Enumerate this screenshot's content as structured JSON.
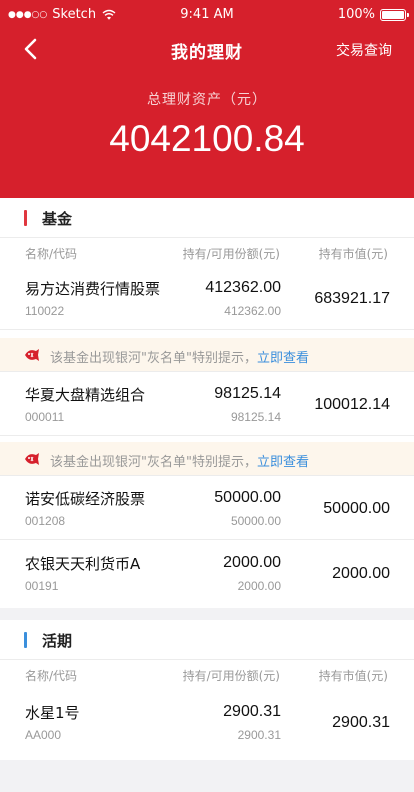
{
  "status_bar": {
    "signal": "●●●○○",
    "carrier": "Sketch",
    "time": "9:41 AM",
    "battery": "100%"
  },
  "header": {
    "title": "我的理财",
    "right_action": "交易查询",
    "total_label": "总理财资产（元）",
    "total_value": "4042100.84"
  },
  "colors": {
    "brand_red": "#d6202c",
    "fund_bar": "#e0373f",
    "current_bar": "#3b8fdc",
    "link_blue": "#3b8fdc",
    "notice_bg": "#fdf6ec"
  },
  "fund_section": {
    "title": "基金",
    "col_name": "名称/代码",
    "col_hold": "持有/可用份额(元)",
    "col_mkt": "持有市值(元)",
    "rows": [
      {
        "name": "易方达消费行情股票",
        "code": "110022",
        "hold": "412362.00",
        "avail": "412362.00",
        "mkt": "683921.17"
      },
      {
        "name": "华夏大盘精选组合",
        "code": "000011",
        "hold": "98125.14",
        "avail": "98125.14",
        "mkt": "100012.14"
      },
      {
        "name": "诺安低碳经济股票",
        "code": "001208",
        "hold": "50000.00",
        "avail": "50000.00",
        "mkt": "50000.00"
      },
      {
        "name": "农银天天利货币A",
        "code": "00191",
        "hold": "2000.00",
        "avail": "2000.00",
        "mkt": "2000.00"
      }
    ],
    "notice_text": "该基金出现银河\"灰名单\"特别提示，",
    "notice_link": "立即查看"
  },
  "current_section": {
    "title": "活期",
    "col_name": "名称/代码",
    "col_hold": "持有/可用份额(元)",
    "col_mkt": "持有市值(元)",
    "rows": [
      {
        "name": "水星1号",
        "code": "AA000",
        "hold": "2900.31",
        "avail": "2900.31",
        "mkt": "2900.31"
      }
    ]
  }
}
